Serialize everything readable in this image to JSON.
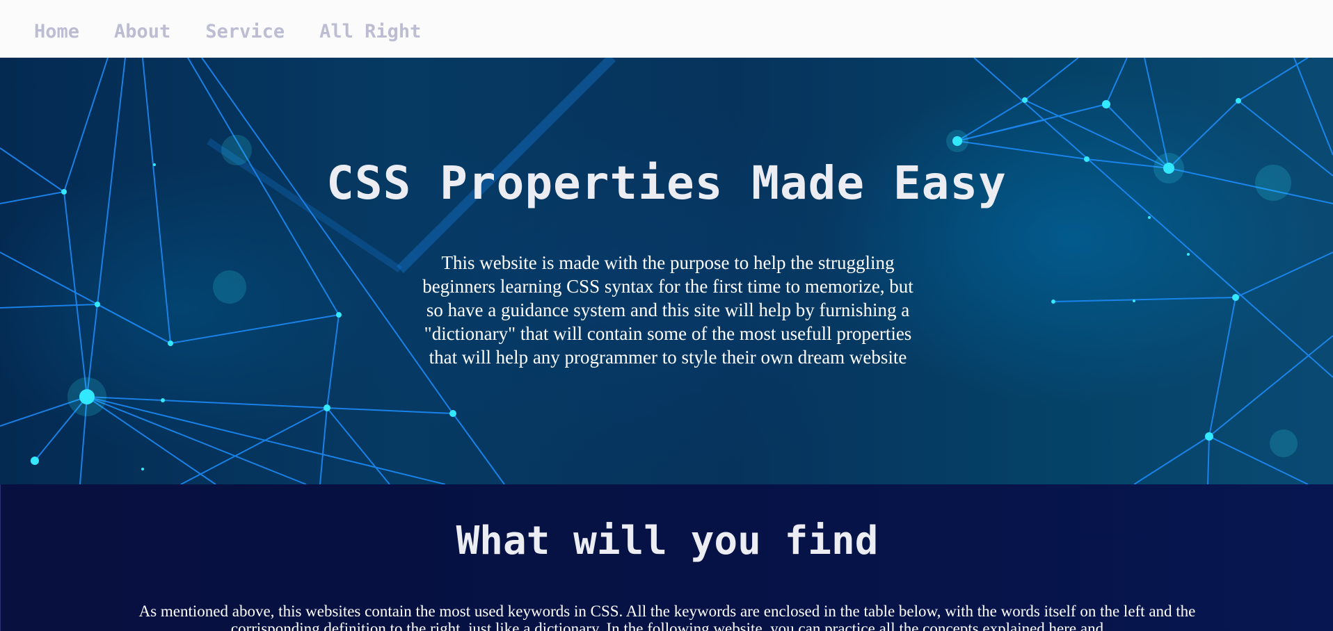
{
  "nav": {
    "items": [
      {
        "label": "Home"
      },
      {
        "label": "About"
      },
      {
        "label": "Service"
      },
      {
        "label": "All Right"
      }
    ]
  },
  "hero": {
    "title": "CSS Properties Made Easy",
    "description": "This website is made with the purpose to help the struggling beginners learning CSS syntax for the first time to memorize, but so have a guidance system and this site will help by furnishing a \"dictionary\" that will contain some of the most usefull properties that will help any programmer to style their own dream website"
  },
  "find_section": {
    "title": "What will you find",
    "description": "As mentioned above, this websites contain the most used keywords in CSS. All the keywords are enclosed in the table below, with the words itself on the left and the corrisponding definition to the right, just like a dictionary. In the following website, you can practice all the concepts explained here and"
  },
  "colors": {
    "nav_background": "#fbfbfc",
    "nav_text": "#bcbdd3",
    "hero_background": "#05355e",
    "network_lines": "#1e8fff",
    "network_nodes": "#33e8ff",
    "section_background": "#061245",
    "heading_text": "#ecedf3"
  }
}
